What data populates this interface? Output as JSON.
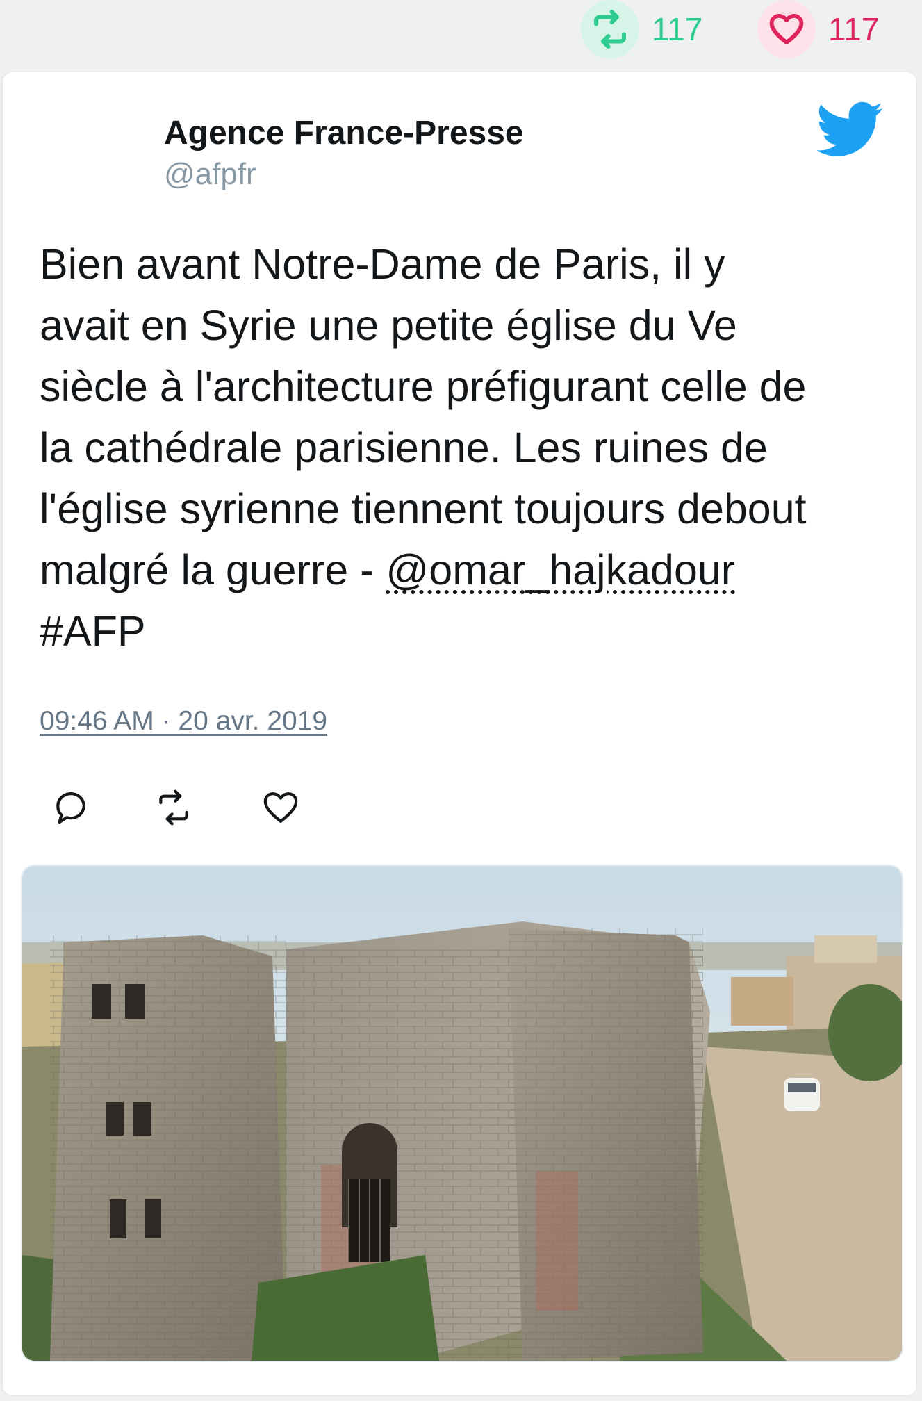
{
  "stats": {
    "retweet_count": "117",
    "like_count": "117"
  },
  "tweet": {
    "author_name": "Agence France-Presse",
    "author_handle": "@afpfr",
    "text_before_mention": "Bien avant Notre-Dame de Paris, il y\navait en Syrie une petite église du Ve\nsiècle à l'architecture préfigurant celle de\nla cathédrale parisienne. Les ruines de\nl'église syrienne tiennent toujours debout\nmalgré la guerre - ",
    "mention": "@omar_hajkadour",
    "hashtag": "#AFP",
    "timestamp": "09:46 AM · 20 avr. 2019"
  },
  "icons": {
    "retweet": "retweet-icon",
    "like": "heart-icon",
    "reply": "reply-icon",
    "brand": "twitter-bird-icon"
  },
  "colors": {
    "retweet_green": "#2ecc8f",
    "like_pink": "#e0245e",
    "twitter_blue": "#1da1f2",
    "handle_gray": "#8899a6"
  }
}
